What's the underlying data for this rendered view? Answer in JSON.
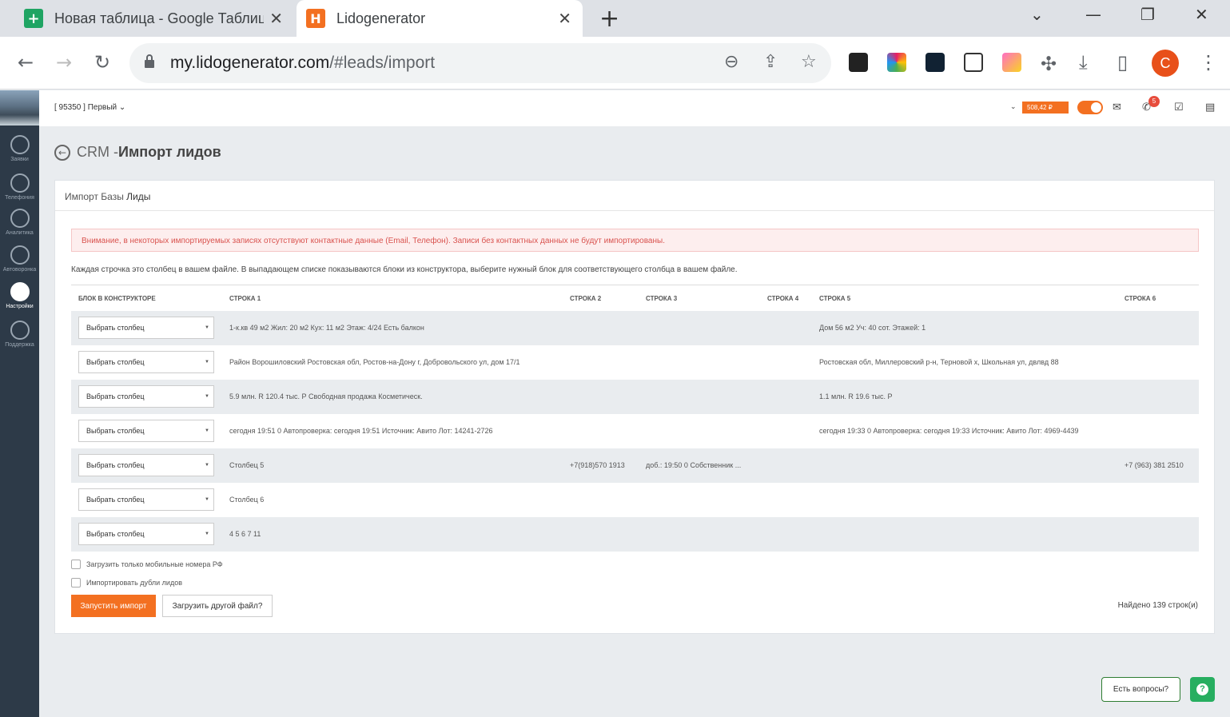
{
  "browser": {
    "tabs": [
      {
        "title": "Новая таблица - Google Таблиц",
        "favicon": "sheets-icon"
      },
      {
        "title": "Lidogenerator",
        "favicon": "lidogenerator-icon",
        "active": true
      }
    ],
    "url_host": "my.lidogenerator.com",
    "url_path": "/#leads/import",
    "profile_initial": "С"
  },
  "sidebar": {
    "items": [
      {
        "label": "Заявки",
        "icon": "list-icon"
      },
      {
        "label": "Телефония",
        "icon": "phone-icon"
      },
      {
        "label": "Аналитика",
        "icon": "analytics-icon"
      },
      {
        "label": "Автоворонка",
        "icon": "mail-funnel-icon"
      },
      {
        "label": "Настройки",
        "icon": "settings-icon",
        "active": true
      },
      {
        "label": "Поддержка",
        "icon": "chat-icon"
      }
    ]
  },
  "topbar": {
    "account": "[ 95350 ] Первый",
    "balance": "508,42 ₽",
    "notifications": "5"
  },
  "page": {
    "crumb": "CRM - ",
    "title": "Импорт лидов"
  },
  "card": {
    "head_prefix": "Импорт Базы ",
    "head_bold": "Лиды",
    "alert": "Внимание, в некоторых импортируемых записях отсутствуют контактные данные (Email, Телефон). Записи без контактных данных не будут импортированы.",
    "hint": "Каждая строчка это столбец в вашем файле. В выпадающем списке показываются блоки из конструктора, выберите нужный блок для соответствующего столбца в вашем файле."
  },
  "table": {
    "headers": [
      "БЛОК В КОНСТРУКТОРЕ",
      "СТРОКА 1",
      "СТРОКА 2",
      "СТРОКА 3",
      "СТРОКА 4",
      "СТРОКА 5",
      "СТРОКА 6"
    ],
    "select_placeholder": "Выбрать столбец",
    "rows": [
      [
        "1-к.кв 49 м2 Жил: 20 м2 Кух: 11 м2 Этаж: 4/24 Есть балкон",
        "",
        "",
        "",
        "Дом 56 м2 Уч: 40 сот. Этажей: 1",
        ""
      ],
      [
        "Район Ворошиловский Ростовская обл, Ростов-на-Дону г, Добровольского ул, дом 17/1",
        "",
        "",
        "",
        "Ростовская обл, Миллеровский р-н, Терновой х, Школьная ул, двлвд 88",
        ""
      ],
      [
        "5.9 млн. R 120.4 тыс. Р Свободная продажа Косметическ.",
        "",
        "",
        "",
        "1.1 млн. R 19.6 тыс. Р",
        ""
      ],
      [
        "сегодня 19:51 0 Автопроверка: сегодня 19:51 Источник: Авито Лот: 14241-2726",
        "",
        "",
        "",
        "сегодня 19:33 0 Автопроверка: сегодня 19:33 Источник: Авито Лот: 4969-4439",
        ""
      ],
      [
        "Столбец 5",
        "+7(918)570 1913",
        "доб.: 19:50 0 Собственник ...",
        "",
        "",
        "+7 (963) 381 2510"
      ],
      [
        "Столбец 6",
        "",
        "",
        "",
        "",
        ""
      ],
      [
        "4 5 6 7 11",
        "",
        "",
        "",
        "",
        ""
      ]
    ]
  },
  "options": {
    "mobile_only": "Загрузить только мобильные номера РФ",
    "import_dupes": "Импортировать дубли лидов"
  },
  "actions": {
    "run": "Запустить импорт",
    "other_file": "Загрузить другой файл?",
    "found": "Найдено 139 строк(и)"
  },
  "support": {
    "ask": "Есть вопросы?",
    "help": "?"
  },
  "colors": {
    "accent": "#f37021",
    "sidebar": "#2d3a48",
    "alert_text": "#d9534f",
    "help_green": "#27ae60"
  }
}
